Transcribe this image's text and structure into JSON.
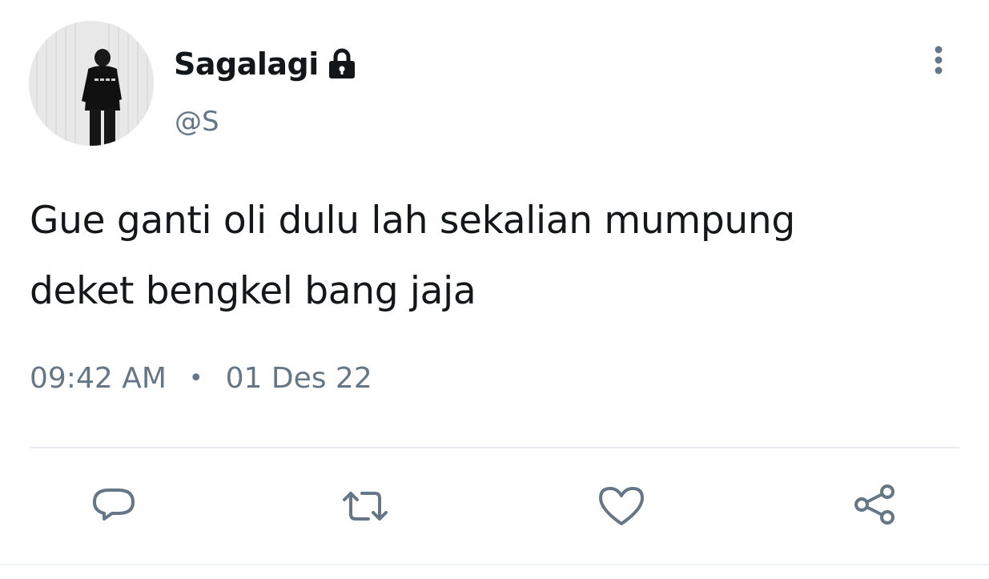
{
  "tweet": {
    "display_name": "Sagalagi",
    "handle": "@S",
    "text_line_1": "Gue ganti oli dulu lah sekalian mumpung",
    "text_line_2": "deket bengkel bang jaja",
    "time": "09:42 AM",
    "separator": "•",
    "date": "01 Des 22",
    "protected_icon": "lock-icon"
  },
  "actions": {
    "reply_icon": "reply-icon",
    "retweet_icon": "retweet-icon",
    "like_icon": "heart-icon",
    "share_icon": "share-icon"
  },
  "colors": {
    "text_primary": "#14171a",
    "text_secondary": "#657786",
    "divider": "#e6ecf0"
  }
}
